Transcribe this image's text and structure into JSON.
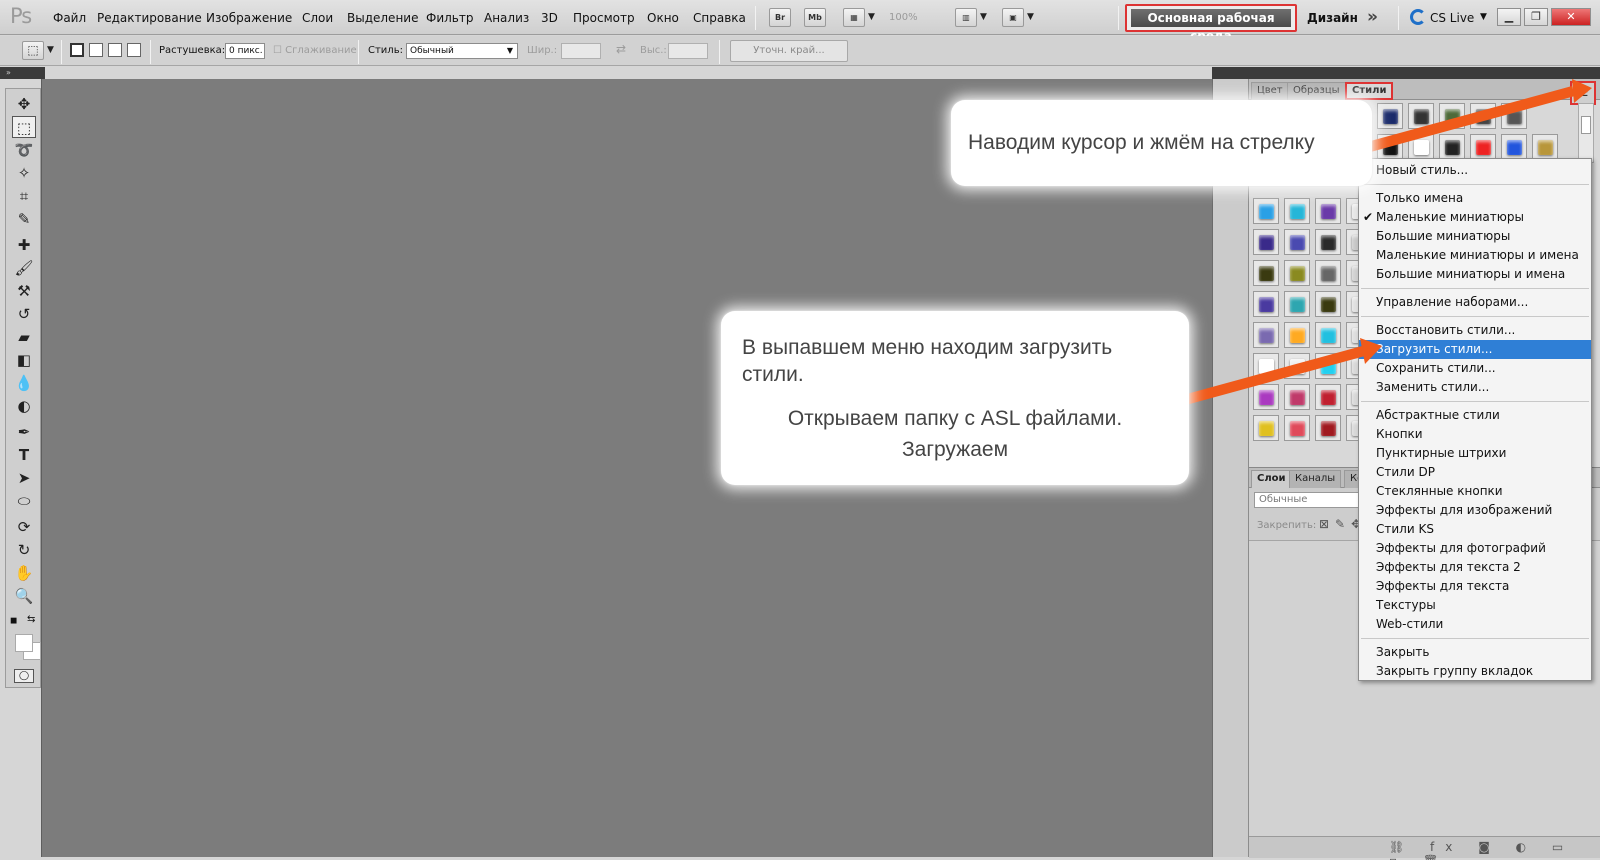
{
  "app": {
    "logo": "Ps"
  },
  "menu": {
    "items": [
      "Файл",
      "Редактирование",
      "Изображение",
      "Слои",
      "Выделение",
      "Фильтр",
      "Анализ",
      "3D",
      "Просмотр",
      "Окно",
      "Справка"
    ],
    "bridge_label": "Br",
    "minibridge_label": "Mb",
    "zoom": "100%",
    "workspace": "Основная рабочая среда",
    "design": "Дизайн",
    "more_icon": "double-chevron-right-icon",
    "cs_live": "CS Live",
    "window_buttons": [
      "minimize",
      "restore",
      "close"
    ]
  },
  "options": {
    "feather_label": "Растушевка:",
    "feather_value": "0 пикс.",
    "antialias_label": "Сглаживание",
    "style_label": "Стиль:",
    "style_value": "Обычный",
    "width_label": "Шир.:",
    "height_label": "Выс.:",
    "refine_edge": "Уточн. край..."
  },
  "tools": [
    "move-tool-icon",
    "marquee-tool-icon",
    "lasso-tool-icon",
    "quick-selection-icon",
    "crop-tool-icon",
    "eyedropper-icon",
    "healing-brush-icon",
    "brush-icon",
    "clone-stamp-icon",
    "history-brush-icon",
    "eraser-icon",
    "gradient-icon",
    "blur-icon",
    "dodge-icon",
    "pen-icon",
    "type-icon",
    "path-selection-icon",
    "ellipse-icon",
    "3d-rotate-icon",
    "3d-orbit-icon",
    "hand-icon",
    "zoom-icon"
  ],
  "styles_panel": {
    "tabs": [
      "Цвет",
      "Образцы",
      "Стили"
    ],
    "active_tab": "Стили",
    "swatch_colors": [
      "#1a2a6a",
      "#333333",
      "#4e6a3a",
      "#444444",
      "#555555",
      "#111111",
      "#ffffff",
      "#222222",
      "#ee2222",
      "#2255dd",
      "#b8963a",
      "#2aa0e6",
      "#25b6d8",
      "#6a3aa8",
      "#e6e6e6",
      "#3a2a8a",
      "#4a4ab0",
      "#2a2a2a",
      "#c8c8c8",
      "#3a3a10",
      "#8a8a20",
      "#666666",
      "#d0d0d0",
      "#4a3aa0",
      "#2ea6b0",
      "#3a3a10",
      "#e0e0e0",
      "#7a6ab0",
      "#ffaa22",
      "#22c0e0",
      "#dddddd",
      "#ffffff",
      "#eeeeee",
      "#22d0f0",
      "#d8d8d8",
      "#aa3ac0",
      "#c03a6a",
      "#c02030",
      "#d8d8d8",
      "#e0c020",
      "#e04a5a",
      "#a01a20",
      "#d8d8d8"
    ]
  },
  "panel_menu": {
    "items": [
      {
        "label": "Новый стиль...",
        "checked": false,
        "highlighted": false
      },
      {
        "sep": true
      },
      {
        "label": "Только имена",
        "checked": false,
        "highlighted": false
      },
      {
        "label": "Маленькие миниатюры",
        "checked": true,
        "highlighted": false
      },
      {
        "label": "Большие миниатюры",
        "checked": false,
        "highlighted": false
      },
      {
        "label": "Маленькие миниатюры и имена",
        "checked": false,
        "highlighted": false
      },
      {
        "label": "Большие миниатюры и имена",
        "checked": false,
        "highlighted": false
      },
      {
        "sep": true
      },
      {
        "label": "Управление наборами...",
        "checked": false,
        "highlighted": false
      },
      {
        "sep": true
      },
      {
        "label": "Восстановить стили...",
        "checked": false,
        "highlighted": false
      },
      {
        "label": "Загрузить стили...",
        "checked": false,
        "highlighted": true
      },
      {
        "label": "Сохранить стили...",
        "checked": false,
        "highlighted": false
      },
      {
        "label": "Заменить стили...",
        "checked": false,
        "highlighted": false
      },
      {
        "sep": true
      },
      {
        "label": "Абстрактные стили",
        "checked": false,
        "highlighted": false
      },
      {
        "label": "Кнопки",
        "checked": false,
        "highlighted": false
      },
      {
        "label": "Пунктирные штрихи",
        "checked": false,
        "highlighted": false
      },
      {
        "label": "Стили DP",
        "checked": false,
        "highlighted": false
      },
      {
        "label": "Стеклянные кнопки",
        "checked": false,
        "highlighted": false
      },
      {
        "label": "Эффекты для изображений",
        "checked": false,
        "highlighted": false
      },
      {
        "label": "Стили KS",
        "checked": false,
        "highlighted": false
      },
      {
        "label": "Эффекты для фотографий",
        "checked": false,
        "highlighted": false
      },
      {
        "label": "Эффекты для текста 2",
        "checked": false,
        "highlighted": false
      },
      {
        "label": "Эффекты для текста",
        "checked": false,
        "highlighted": false
      },
      {
        "label": "Текстуры",
        "checked": false,
        "highlighted": false
      },
      {
        "label": "Web-стили",
        "checked": false,
        "highlighted": false
      },
      {
        "sep": true
      },
      {
        "label": "Закрыть",
        "checked": false,
        "highlighted": false
      },
      {
        "label": "Закрыть группу вкладок",
        "checked": false,
        "highlighted": false
      }
    ]
  },
  "layers_panel": {
    "tabs": [
      "Слои",
      "Каналы",
      "Ко"
    ],
    "blend_mode": "Обычные",
    "lock_label": "Закрепить:"
  },
  "callouts": {
    "first": "Наводим курсор и жмём на стрелку",
    "second_line1": "В выпавшем меню находим загрузить стили.",
    "second_line2": "Открываем папку с ASL файлами.",
    "second_line3": "Загружаем"
  },
  "colors": {
    "accent": "#2f7fd6",
    "highlight_border": "#dd3333",
    "arrow": "#f05a1a",
    "canvas": "#7c7c7c"
  }
}
